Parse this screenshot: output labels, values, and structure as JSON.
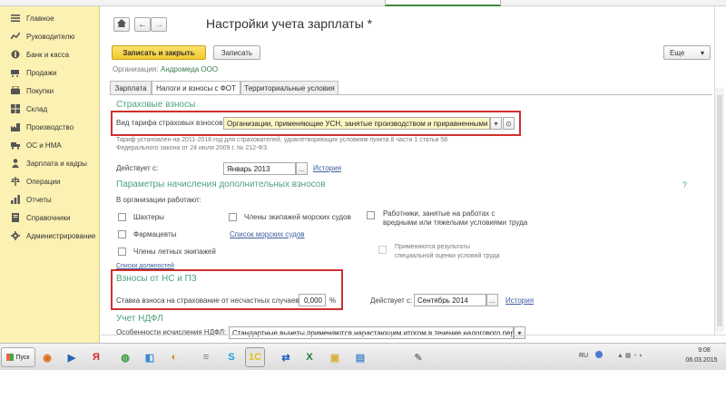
{
  "sidebar": {
    "items": [
      {
        "label": "Главное",
        "icon": "menu-icon"
      },
      {
        "label": "Руководителю",
        "icon": "trend-icon"
      },
      {
        "label": "Банк и касса",
        "icon": "coin-icon"
      },
      {
        "label": "Продажи",
        "icon": "cart-icon"
      },
      {
        "label": "Покупки",
        "icon": "basket-icon"
      },
      {
        "label": "Склад",
        "icon": "warehouse-icon"
      },
      {
        "label": "Производство",
        "icon": "factory-icon"
      },
      {
        "label": "ОС и НМА",
        "icon": "truck-icon"
      },
      {
        "label": "Зарплата и кадры",
        "icon": "person-icon"
      },
      {
        "label": "Операции",
        "icon": "scale-icon"
      },
      {
        "label": "Отчеты",
        "icon": "chart-icon"
      },
      {
        "label": "Справочники",
        "icon": "book-icon"
      },
      {
        "label": "Администрирование",
        "icon": "gear-icon"
      }
    ]
  },
  "header": {
    "home_icon": "home-icon",
    "back_glyph": "←",
    "forward_glyph": "→",
    "title": "Настройки учета зарплаты *"
  },
  "toolbar": {
    "save_close": "Записать и закрыть",
    "save": "Записать",
    "more": "Еще",
    "more_arrow": "▾"
  },
  "organization": {
    "label": "Организация:",
    "value": "Андромеда ООО"
  },
  "tabs": [
    {
      "label": "Зарплата",
      "active": false
    },
    {
      "label": "Налоги и взносы с ФОТ",
      "active": true
    },
    {
      "label": "Территориальные условия",
      "active": false
    }
  ],
  "insurance": {
    "section_title": "Страховые взносы",
    "tariff_label": "Вид тарифа страховых взносов:",
    "tariff_value": "Организации, применяющие УСН, занятые производством и приравненными вида",
    "tariff_dropdown": "▾",
    "tariff_open": "⊙",
    "note_line1": "Тариф установлен на 2011-2018 год для страхователей, удовлетворяющих условиям пункта 8 части 1 статьи 58",
    "note_line2": "Федерального закона от 24 июля 2009 г. № 212-ФЗ.",
    "valid_from_label": "Действует с:",
    "valid_from_value": "Январь 2013",
    "valid_from_btn": "...",
    "history_link": "История"
  },
  "additional": {
    "section_title": "Параметры начисления дополнительных взносов",
    "help": "?",
    "org_works_label": "В организации работают:",
    "miners": "Шахтеры",
    "pharmacists": "Фармацевты",
    "flight_crew": "Члены летных экипажей",
    "sea_crew": "Члены экипажей морских судов",
    "sea_ships_link": "Список морских судов",
    "hazardous_line1": "Работники, занятые на работах с",
    "hazardous_line2": "вредными или тяжелыми условиями труда",
    "special_line1": "Применяются результаты",
    "special_line2": "специальной оценки условий труда",
    "positions_link": "Списки должностей"
  },
  "accident": {
    "section_title": "Взносы от НС и ПЗ",
    "rate_label": "Ставка взноса на страхование от несчастных случаев:",
    "rate_value": "0,000",
    "rate_unit": "%",
    "valid_from_label": "Действует с:",
    "valid_from_value": "Сентябрь 2014",
    "valid_from_btn": "...",
    "history_link": "История"
  },
  "ndfl": {
    "section_title": "Учет НДФЛ",
    "feature_label": "Особенности исчисления НДФЛ:",
    "feature_value": "Стандартные вычеты применяются нарастающим итогом в течение налогового периода",
    "feature_dropdown": "▾"
  },
  "taskbar": {
    "start_label": "Пуск",
    "icons": [
      {
        "name": "taskbar-firefox-icon",
        "glyph": "◉",
        "color": "#e06a1c"
      },
      {
        "name": "taskbar-media-icon",
        "glyph": "▶",
        "color": "#2a62b8"
      },
      {
        "name": "taskbar-yandex-icon",
        "glyph": "Я",
        "color": "#d22a2a"
      },
      {
        "name": "taskbar-chrome-icon",
        "glyph": "◍",
        "color": "#3a9a3a"
      },
      {
        "name": "taskbar-photo-icon",
        "glyph": "◧",
        "color": "#3a8ad0"
      },
      {
        "name": "taskbar-paint-icon",
        "glyph": "◐",
        "color": "#d48a2a"
      },
      {
        "name": "taskbar-notepad-icon",
        "glyph": "≡",
        "color": "#7a7a7a"
      },
      {
        "name": "taskbar-skype-icon",
        "glyph": "S",
        "color": "#1aa2e0"
      },
      {
        "name": "taskbar-1c-icon",
        "glyph": "1С",
        "color": "#e6c21c"
      },
      {
        "name": "taskbar-teamviewer-icon",
        "glyph": "⇄",
        "color": "#1a62c0"
      },
      {
        "name": "taskbar-excel-icon",
        "glyph": "X",
        "color": "#1f7a3a"
      },
      {
        "name": "taskbar-folder-icon",
        "glyph": "▣",
        "color": "#d8b040"
      },
      {
        "name": "taskbar-screen-icon",
        "glyph": "▤",
        "color": "#4a8ad0"
      },
      {
        "name": "taskbar-tool-icon",
        "glyph": "✎",
        "color": "#8a8a8a"
      }
    ],
    "lang": "RU",
    "time": "9:08",
    "date": "06.03.2015"
  },
  "colors": {
    "sidebar_bg": "#fbf1b2",
    "section_green": "#4ea27a",
    "highlight_red": "#d03030",
    "primary_yellow": "#f3c92d"
  }
}
